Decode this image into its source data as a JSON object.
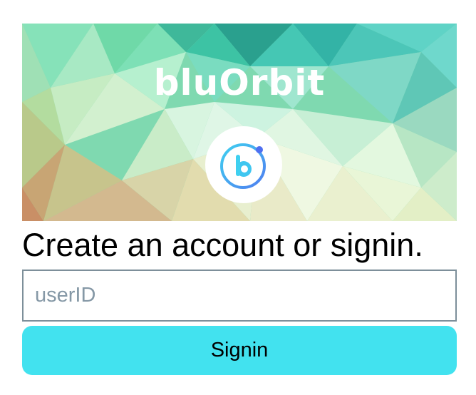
{
  "hero": {
    "brand_name": "bluOrbit",
    "logo_letter": "b",
    "logo_icon": "bluorbit-logo-icon"
  },
  "main": {
    "heading": "Create an account or signin.",
    "userid_placeholder": "userID",
    "userid_value": "",
    "signin_label": "Signin"
  },
  "colors": {
    "button_bg": "#42e2ef",
    "input_border": "#7d8f9a",
    "placeholder": "#8598a6",
    "logo_gradient_start": "#3fd0f0",
    "logo_gradient_end": "#4f7ef0"
  }
}
